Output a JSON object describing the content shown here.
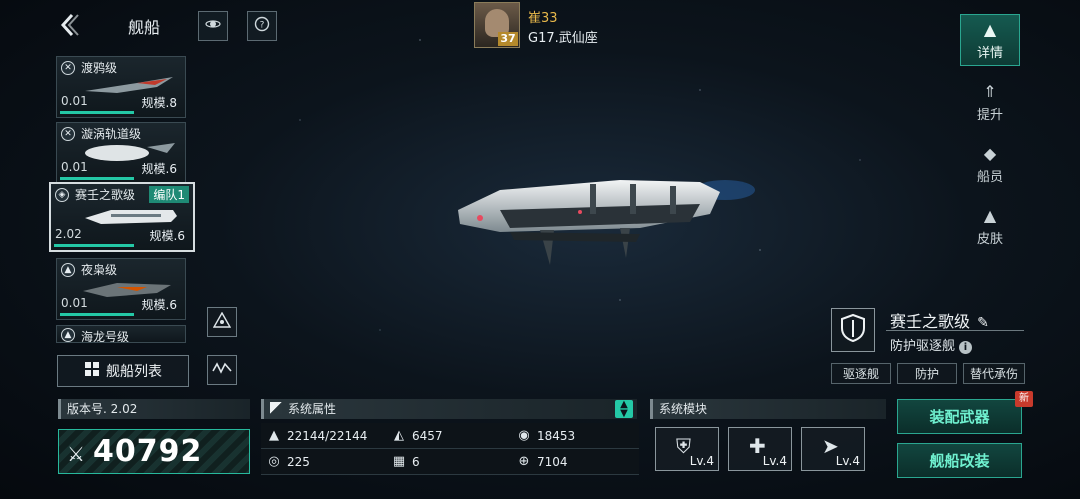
{
  "header": {
    "back_icon": "back-arrow-icon",
    "title": "舰船",
    "rocket_icon": "rocket-icon",
    "help_icon": "help-icon"
  },
  "player": {
    "name": "崔33",
    "level": "37",
    "location": "G17.武仙座"
  },
  "ships": [
    {
      "name": "渡鸦级",
      "value": "0.01",
      "scale": "规模.8",
      "progress": 0.75
    },
    {
      "name": "漩涡轨道级",
      "value": "0.01",
      "scale": "规模.6",
      "progress": 0.75
    },
    {
      "name": "赛壬之歌级",
      "value": "2.02",
      "scale": "规模.6",
      "fleet": "编队1",
      "progress": 0.6
    },
    {
      "name": "夜枭级",
      "value": "0.01",
      "scale": "规模.6",
      "progress": 0.75
    },
    {
      "name": "海龙号级"
    }
  ],
  "ship_list_button": "舰船列表",
  "side_tabs": [
    {
      "label": "详情",
      "icon": "details-icon"
    },
    {
      "label": "提升",
      "icon": "upgrade-icon"
    },
    {
      "label": "船员",
      "icon": "crew-icon"
    },
    {
      "label": "皮肤",
      "icon": "skin-icon"
    }
  ],
  "selected_ship": {
    "name": "赛壬之歌级",
    "role": "防护驱逐舰",
    "tags": [
      "驱逐舰",
      "防护",
      "替代承伤"
    ]
  },
  "version": {
    "label": "版本号. 2.02",
    "power": "40792"
  },
  "system_attributes": {
    "title": "系统属性",
    "items": [
      {
        "icon": "hull-icon",
        "value": "22144/22144"
      },
      {
        "icon": "armor-icon",
        "value": "6457"
      },
      {
        "icon": "shield-icon",
        "value": "18453"
      },
      {
        "icon": "energy-icon",
        "value": "225"
      },
      {
        "icon": "checker-icon",
        "value": "6"
      },
      {
        "icon": "target-icon",
        "value": "7104"
      }
    ]
  },
  "system_modules": {
    "title": "系统模块",
    "slots": [
      {
        "icon": "shield-weapon-icon",
        "level": "Lv.4"
      },
      {
        "icon": "repair-icon",
        "level": "Lv.4"
      },
      {
        "icon": "missile-icon",
        "level": "Lv.4"
      }
    ]
  },
  "actions": {
    "equip_weapon": "装配武器",
    "new_badge": "新",
    "modify_ship": "舰船改装"
  },
  "colors": {
    "accent": "#24c8a6",
    "gold": "#e7b84b",
    "badge": "#c83a2c"
  }
}
